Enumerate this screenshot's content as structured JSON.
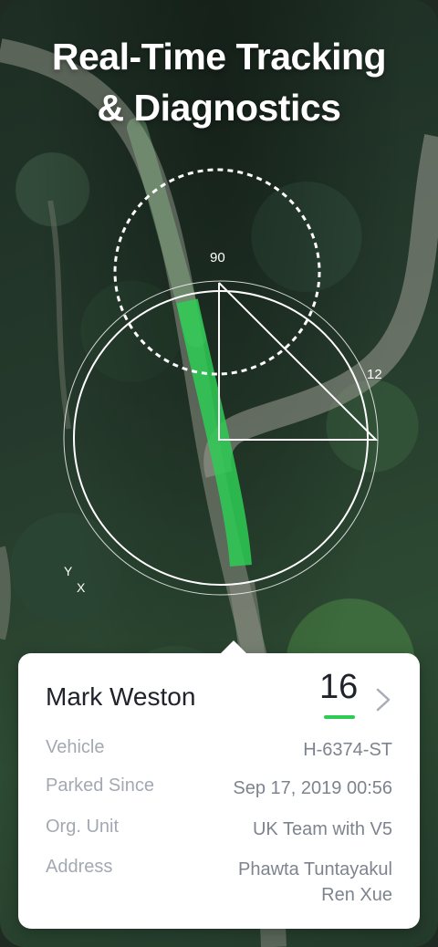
{
  "headline": {
    "line1": "Real-Time Tracking",
    "line2": "& Diagnostics"
  },
  "map": {
    "label_90": "90",
    "label_12": "12",
    "label_y": "Y",
    "label_x": "X",
    "track_color": "#2ecc55"
  },
  "card": {
    "driver_name": "Mark Weston",
    "score": "16",
    "score_color": "#2ecc55",
    "chevron_icon": "chevron-right-icon",
    "rows": [
      {
        "label": "Vehicle",
        "value": "H-6374-ST"
      },
      {
        "label": "Parked Since",
        "value": "Sep 17, 2019 00:56"
      },
      {
        "label": "Org. Unit",
        "value": "UK Team with V5"
      },
      {
        "label": "Address",
        "value_line1": "Phawta Tuntayakul",
        "value_line2": "Ren Xue"
      }
    ]
  }
}
